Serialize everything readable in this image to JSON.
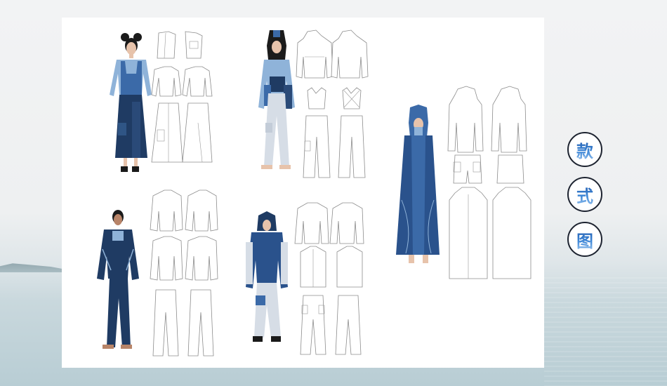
{
  "badges": [
    {
      "char": "款"
    },
    {
      "char": "式"
    },
    {
      "char": "图"
    }
  ],
  "colors": {
    "denim_dark": "#1f3b63",
    "denim_mid": "#3b6aa8",
    "denim_light": "#8fb3d9",
    "pale_grey": "#d6dde6",
    "badge_text": "#2f6fb5"
  }
}
